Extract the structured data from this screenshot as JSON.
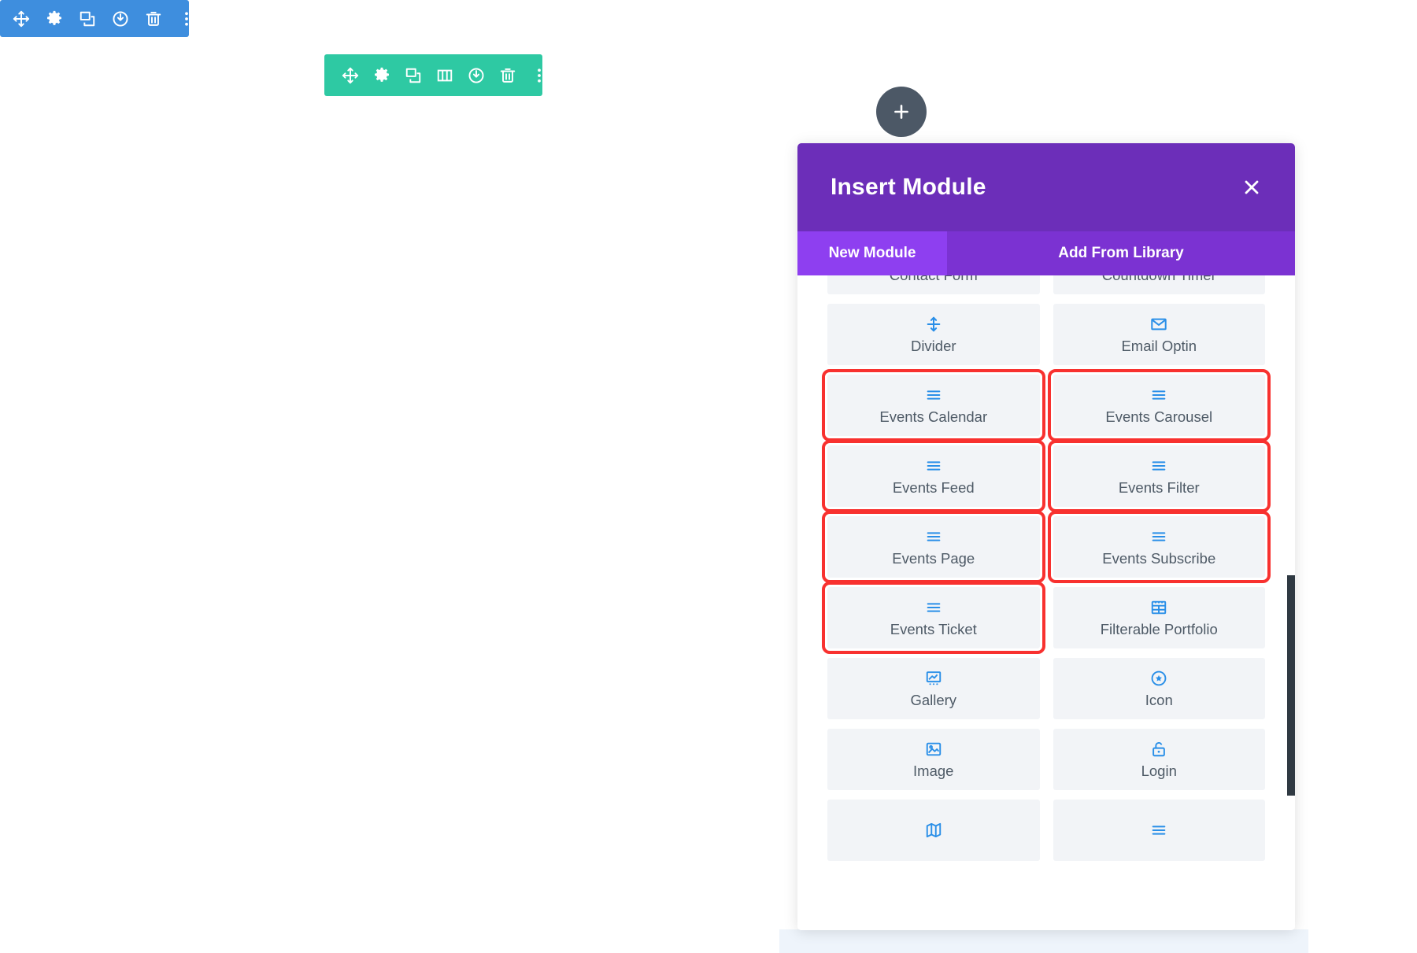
{
  "section_toolbar": {
    "name": "section-settings-toolbar",
    "color": "#3e8ede",
    "buttons": [
      {
        "icon": "move-icon",
        "label": "Move Section"
      },
      {
        "icon": "gear-icon",
        "label": "Section Settings"
      },
      {
        "icon": "duplicate-icon",
        "label": "Duplicate Section"
      },
      {
        "icon": "power-icon",
        "label": "Save Section To Library"
      },
      {
        "icon": "trash-icon",
        "label": "Delete Section"
      },
      {
        "icon": "ellipsis-vertical-icon",
        "label": "More Options"
      }
    ]
  },
  "row_toolbar": {
    "name": "row-settings-toolbar",
    "color": "#2ec9a3",
    "buttons": [
      {
        "icon": "move-icon",
        "label": "Move Row"
      },
      {
        "icon": "gear-icon",
        "label": "Row Settings"
      },
      {
        "icon": "duplicate-icon",
        "label": "Duplicate Row"
      },
      {
        "icon": "columns-icon",
        "label": "Change Column Structure"
      },
      {
        "icon": "power-icon",
        "label": "Save Row To Library"
      },
      {
        "icon": "trash-icon",
        "label": "Delete Row"
      },
      {
        "icon": "ellipsis-vertical-icon",
        "label": "More Options"
      }
    ]
  },
  "add_button": {
    "icon": "plus-icon",
    "label": "Insert Module",
    "color": "#4c5866"
  },
  "modal": {
    "title": "Insert Module",
    "close_label": "×",
    "accent_color": "#6c2eb9",
    "tabs": [
      {
        "label": "New Module",
        "active": true
      },
      {
        "label": "Add From Library",
        "active": false
      }
    ],
    "modules": [
      {
        "label": "Contact Form",
        "icon": "contact-form-icon",
        "highlighted": false,
        "clipped_top": true
      },
      {
        "label": "Countdown Timer",
        "icon": "countdown-timer-icon",
        "highlighted": false,
        "clipped_top": true
      },
      {
        "label": "Divider",
        "icon": "divider-icon",
        "highlighted": false
      },
      {
        "label": "Email Optin",
        "icon": "envelope-icon",
        "highlighted": false
      },
      {
        "label": "Events Calendar",
        "icon": "menu-lines-icon",
        "highlighted": true
      },
      {
        "label": "Events Carousel",
        "icon": "menu-lines-icon",
        "highlighted": true
      },
      {
        "label": "Events Feed",
        "icon": "menu-lines-icon",
        "highlighted": true
      },
      {
        "label": "Events Filter",
        "icon": "menu-lines-icon",
        "highlighted": true
      },
      {
        "label": "Events Page",
        "icon": "menu-lines-icon",
        "highlighted": true
      },
      {
        "label": "Events Subscribe",
        "icon": "menu-lines-icon",
        "highlighted": true
      },
      {
        "label": "Events Ticket",
        "icon": "menu-lines-icon",
        "highlighted": true
      },
      {
        "label": "Filterable Portfolio",
        "icon": "grid-table-icon",
        "highlighted": false
      },
      {
        "label": "Gallery",
        "icon": "gallery-icon",
        "highlighted": false
      },
      {
        "label": "Icon",
        "icon": "star-circle-icon",
        "highlighted": false
      },
      {
        "label": "Image",
        "icon": "image-icon",
        "highlighted": false
      },
      {
        "label": "Login",
        "icon": "unlock-icon",
        "highlighted": false
      },
      {
        "label": "",
        "icon": "map-icon",
        "highlighted": false,
        "clipped_bottom": true
      },
      {
        "label": "",
        "icon": "menu-lines-icon",
        "highlighted": false,
        "clipped_bottom": true
      }
    ],
    "highlight_color": "#f8312f",
    "scrollbar": {
      "name": "module-list-scrollbar"
    }
  }
}
